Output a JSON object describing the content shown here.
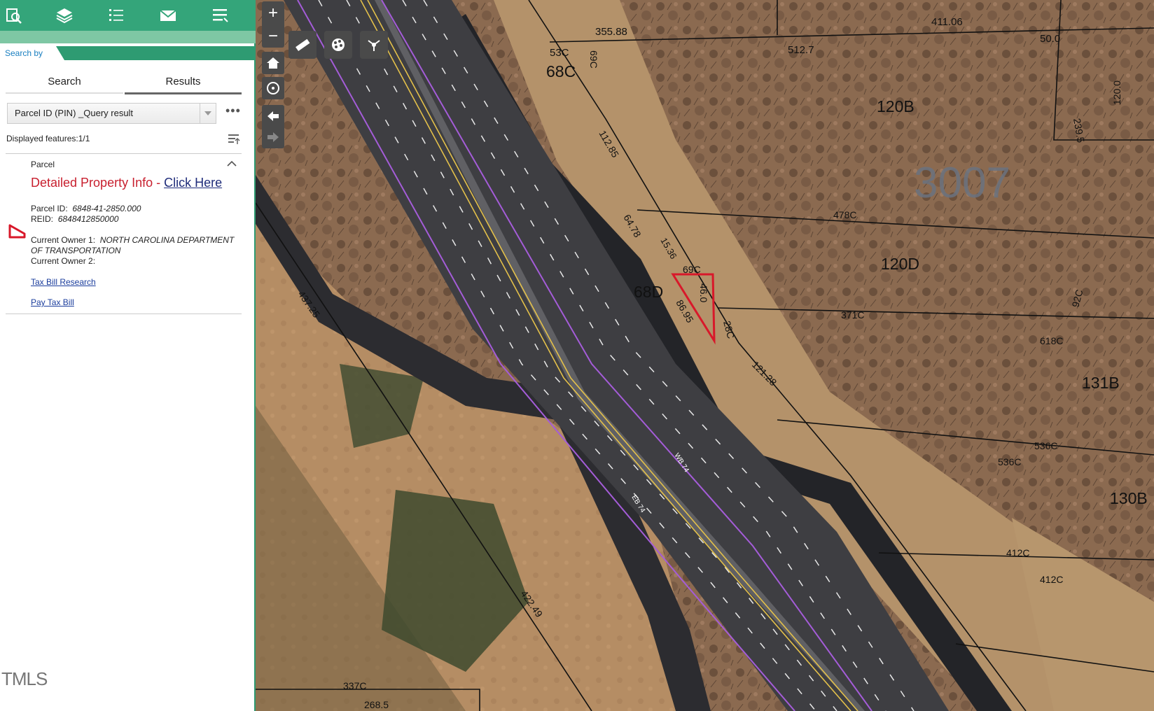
{
  "sidebar": {
    "search_by": "Search by",
    "tabs": {
      "search": "Search",
      "results": "Results"
    },
    "select_value": "Parcel ID (PIN) _Query result",
    "displayed_features": "Displayed features:1/1",
    "parcel_heading": "Parcel",
    "detailed_text": "Detailed Property Info - ",
    "detailed_link": "Click Here",
    "parcel_id_label": "Parcel ID:",
    "parcel_id_value": "6848-41-2850.000",
    "reid_label": "REID:",
    "reid_value": "6848412850000",
    "owner1_label": "Current Owner 1:",
    "owner1_value_a": "NORTH CAROLINA DEPARTMENT",
    "owner1_value_b": "OF TRANSPORTATION",
    "owner2_label": "Current Owner 2:",
    "tax_bill_research": "Tax Bill Research",
    "pay_tax_bill": "Pay Tax Bill",
    "watermark": "TMLS"
  },
  "map": {
    "labels": {
      "l_35588": "355.88",
      "l_41106": "411.06",
      "l_5127": "512.7",
      "l_500": "50.0",
      "l_53C": "53C",
      "l_68C": "68C",
      "l_69C": "69C",
      "l_120B": "120B",
      "l_1200": "120.0",
      "l_2395": "239.5",
      "l_3007": "3007",
      "l_11285": "112.85",
      "l_478C": "478C",
      "l_6478": "64.78",
      "l_1536": "15.36",
      "l_120D": "120D",
      "l_68D": "68D",
      "l_8695": "86.95",
      "l_460": "46.0",
      "l_371C": "371C",
      "l_92C": "92C",
      "l_28C": "28C",
      "l_618C": "618C",
      "l_12128": "121.28",
      "l_131B": "131B",
      "l_536C_a": "536C",
      "l_536C_b": "536C",
      "l_130B": "130B",
      "l_412C_a": "412C",
      "l_412C_b": "412C",
      "l_4372": "437.25",
      "l_42249": "422.49",
      "l_337C": "337C",
      "l_2685": "268.5",
      "l_WB74": "WB 74",
      "l_EB74": "EB 74"
    }
  },
  "colors": {
    "brand_green": "#34a57a",
    "highlight_red": "#d8182a",
    "link_blue": "#1a3c9c"
  }
}
